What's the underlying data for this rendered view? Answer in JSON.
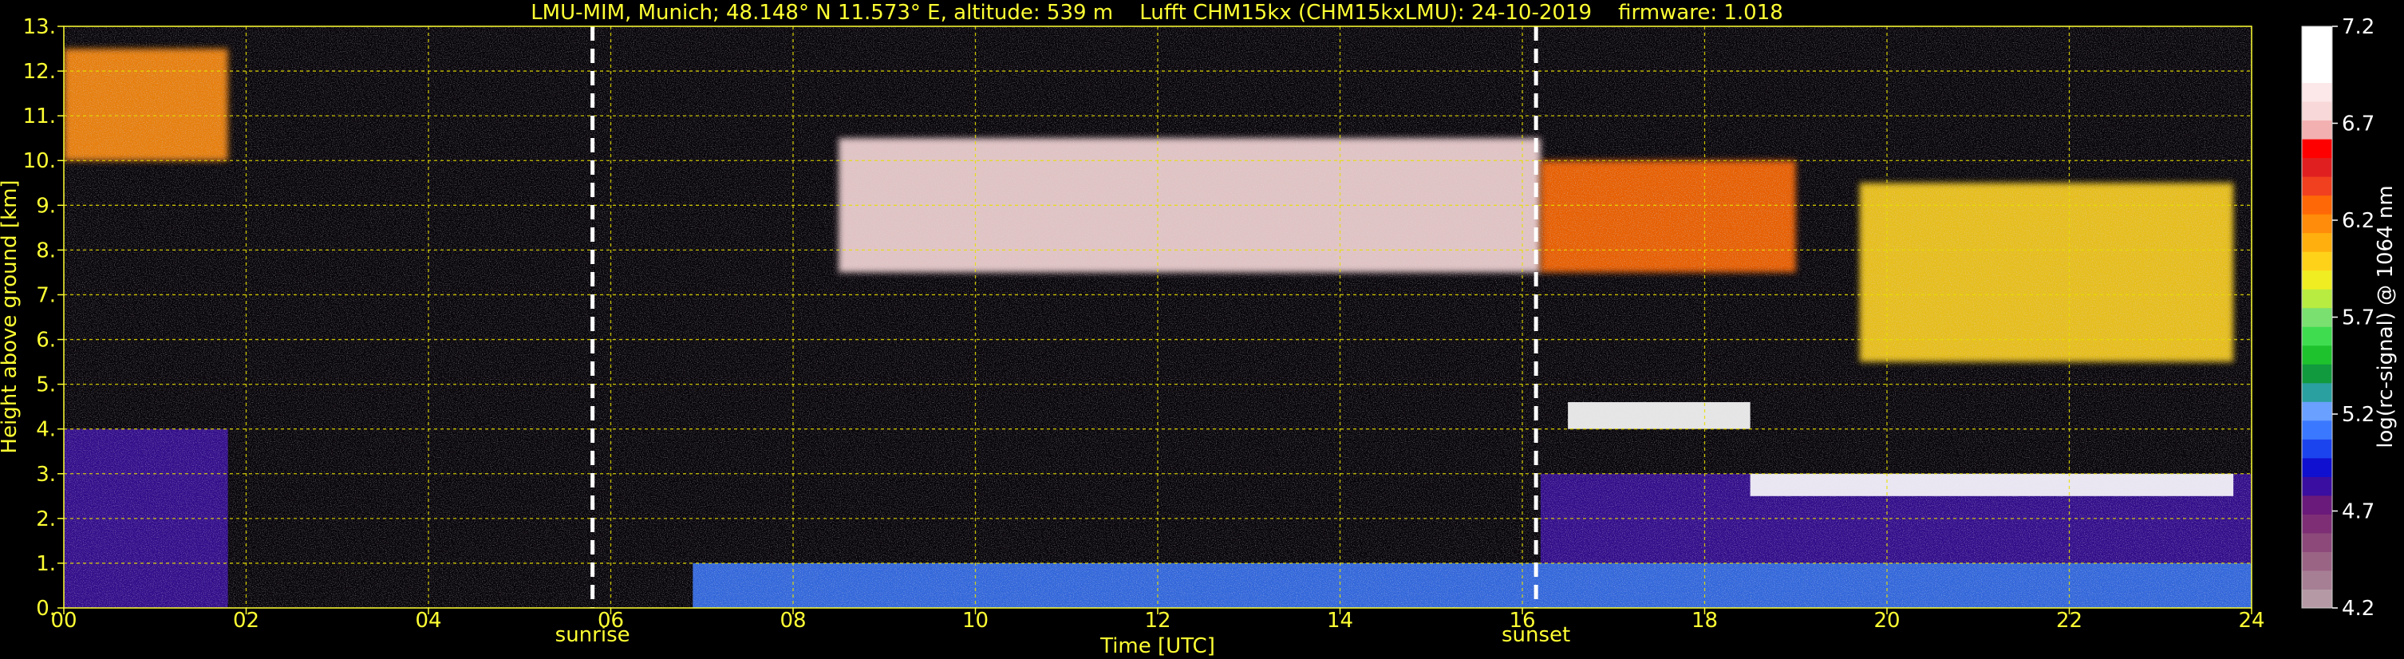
{
  "chart_data": {
    "type": "heatmap",
    "title": "LMU-MIM, Munich; 48.148° N 11.573° E, altitude: 539 m    Lufft CHM15kx (CHM15kxLMU): 24-10-2019    firmware: 1.018",
    "xlabel": "Time [UTC]",
    "ylabel": "Height above ground [km]",
    "xlim": [
      0,
      24
    ],
    "ylim": [
      0,
      13
    ],
    "x_ticks": [
      "00",
      "02",
      "04",
      "06",
      "08",
      "10",
      "12",
      "14",
      "16",
      "18",
      "20",
      "22",
      "24"
    ],
    "y_ticks": [
      "0.",
      "1.",
      "2.",
      "3.",
      "4.",
      "5.",
      "6.",
      "7.",
      "8.",
      "9.",
      "10.",
      "11.",
      "12.",
      "13."
    ],
    "grid": true,
    "events": [
      {
        "label": "sunrise",
        "time": 5.8
      },
      {
        "label": "sunset",
        "time": 16.15
      }
    ],
    "colorbar": {
      "label": "log(rc-signal) @ 1064 nm",
      "range": [
        4.2,
        7.2
      ],
      "ticks": [
        "4.2",
        "4.7",
        "5.2",
        "5.7",
        "6.2",
        "6.7",
        "7.2"
      ],
      "colors": [
        "#b59aa5",
        "#a77f94",
        "#9a6485",
        "#8c497a",
        "#7d2e75",
        "#6a1a7a",
        "#3a0ea0",
        "#1010d0",
        "#1c44ee",
        "#3a78ff",
        "#6aa0ff",
        "#2aa0a0",
        "#129a3e",
        "#1ec22c",
        "#40dc50",
        "#7ae070",
        "#b8ec40",
        "#f0ee22",
        "#ffd21a",
        "#ffb00e",
        "#ff8c0a",
        "#ff6806",
        "#f04020",
        "#e02020",
        "#ff0000",
        "#f3b0b0",
        "#f8d8d8",
        "#fce8e8",
        "#ffffff",
        "#ffffff",
        "#ffffff"
      ]
    },
    "features": [
      {
        "kind": "aerosol_layer",
        "t_start": 0.0,
        "t_end": 1.8,
        "h_bottom": 0.0,
        "h_top": 4.0,
        "level": 4.8
      },
      {
        "kind": "aerosol_layer",
        "t_start": 6.9,
        "t_end": 24.0,
        "h_bottom": 0.0,
        "h_top": 1.0,
        "level": 5.1
      },
      {
        "kind": "aerosol_layer",
        "t_start": 16.2,
        "t_end": 24.0,
        "h_bottom": 1.0,
        "h_top": 3.0,
        "level": 4.8
      },
      {
        "kind": "cirrus",
        "t_start": 0.0,
        "t_end": 1.8,
        "h_bottom": 10.0,
        "h_top": 12.5,
        "level": 6.2
      },
      {
        "kind": "cirrus",
        "t_start": 8.5,
        "t_end": 16.2,
        "h_bottom": 7.5,
        "h_top": 10.5,
        "level": 6.8
      },
      {
        "kind": "cirrus",
        "t_start": 16.2,
        "t_end": 19.0,
        "h_bottom": 7.5,
        "h_top": 10.0,
        "level": 6.3
      },
      {
        "kind": "cirrus",
        "t_start": 19.7,
        "t_end": 23.8,
        "h_bottom": 5.5,
        "h_top": 9.5,
        "level": 6.0
      },
      {
        "kind": "cloud_top",
        "t_start": 16.5,
        "t_end": 18.5,
        "h_bottom": 4.0,
        "h_top": 4.6,
        "level": 7.2
      },
      {
        "kind": "cloud_top",
        "t_start": 18.5,
        "t_end": 23.8,
        "h_bottom": 2.5,
        "h_top": 3.0,
        "level": 7.0
      }
    ]
  }
}
